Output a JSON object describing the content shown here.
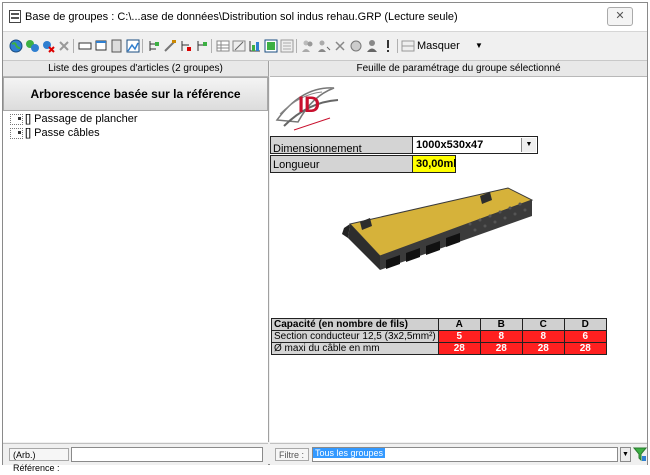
{
  "window": {
    "title": "Base de groupes : C:\\...ase de données\\Distribution sol indus rehau.GRP (Lecture seule)",
    "close_glyph": "✕"
  },
  "toolbar": {
    "mask_label": "Masquer",
    "mask_arrow": "▼"
  },
  "left_panel": {
    "header": "Liste des groupes d'articles (2 groupes)",
    "tree_title": "Arborescence basée sur la référence",
    "items": [
      {
        "label": "[] Passage de plancher"
      },
      {
        "label": "[] Passe câbles"
      }
    ],
    "bottom_label": "(Arb.) Référence :",
    "reference_value": ""
  },
  "right_panel": {
    "header": "Feuille de paramétrage du groupe sélectionné",
    "params": [
      {
        "label": "Dimensionnement",
        "value": "1000x530x47",
        "color": "#ffffff"
      },
      {
        "label": "Longueur",
        "value": "30,00ml",
        "color": "#ffff00"
      }
    ],
    "dropdown_arrow": "▼",
    "capacity": {
      "title": "Capacité (en nombre de fils)",
      "columns": [
        "A",
        "B",
        "C",
        "D"
      ],
      "rows": [
        {
          "label": "Section conducteur 12,5 (3x2,5mm²)",
          "values": [
            "5",
            "8",
            "8",
            "6"
          ]
        },
        {
          "label": "Ø maxi du câble en mm",
          "values": [
            "28",
            "28",
            "28",
            "28"
          ]
        }
      ]
    },
    "filter_label": "Filtre :",
    "filter_value": "Tous les groupes"
  },
  "colors": {
    "cell_red": "#ff2020",
    "highlight_yellow": "#ffff00",
    "selection_blue": "#3399ff"
  }
}
